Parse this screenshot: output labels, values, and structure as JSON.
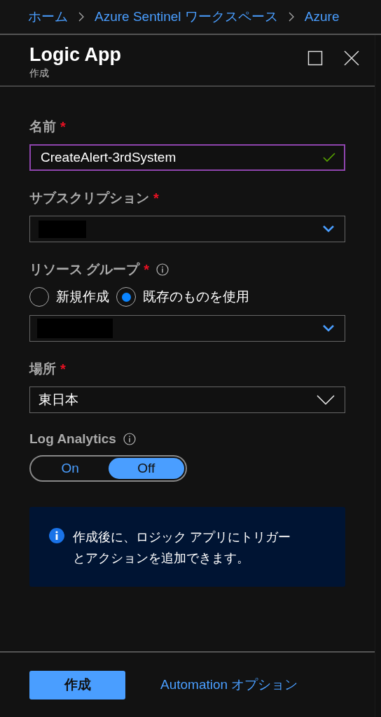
{
  "breadcrumb": [
    {
      "label": "ホーム"
    },
    {
      "label": "Azure Sentinel ワークスペース"
    },
    {
      "label": "Azure"
    }
  ],
  "panel": {
    "title": "Logic App",
    "subtitle": "作成"
  },
  "fields": [
    {
      "kind": "text",
      "label": "名前",
      "required_mark": "*",
      "value": "CreateAlert-3rdSystem",
      "valid": true
    },
    {
      "kind": "select",
      "label": "サブスクリプション",
      "required_mark": "*",
      "redacted": true
    },
    {
      "kind": "radio-select",
      "label": "リソース グループ",
      "required_mark": "*",
      "info": true,
      "options": [
        {
          "label": "新規作成",
          "selected": false
        },
        {
          "label": "既存のものを使用",
          "selected": true
        }
      ],
      "redacted": true
    },
    {
      "kind": "select",
      "label": "場所",
      "required_mark": "*",
      "value": "東日本"
    },
    {
      "kind": "toggle",
      "label": "Log Analytics",
      "info": true,
      "options": [
        {
          "label": "On",
          "selected": false
        },
        {
          "label": "Off",
          "selected": true
        }
      ]
    }
  ],
  "notice": {
    "text": "作成後に、ロジック アプリにトリガーとアクションを追加できます。"
  },
  "footer": {
    "primary": "作成",
    "link": "Automation オプション"
  }
}
